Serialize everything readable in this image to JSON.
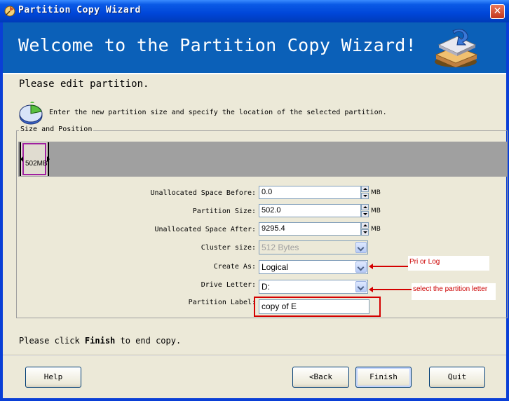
{
  "window": {
    "title": "Partition Copy Wizard",
    "close_glyph": "✕"
  },
  "banner": {
    "title": "Welcome to the Partition Copy Wizard!"
  },
  "heading": "Please edit partition.",
  "info_text": "Enter the new partition size and specify the location of the selected partition.",
  "group": {
    "legend": "Size and Position",
    "map_label": "502MB"
  },
  "fields": {
    "unalloc_before": {
      "label": "Unallocated Space Before:",
      "value": "0.0",
      "unit": "MB"
    },
    "partition_size": {
      "label": "Partition Size:",
      "value": "502.0",
      "unit": "MB"
    },
    "unalloc_after": {
      "label": "Unallocated Space After:",
      "value": "9295.4",
      "unit": "MB"
    },
    "cluster_size": {
      "label": "Cluster size:",
      "value": "512 Bytes"
    },
    "create_as": {
      "label": "Create As:",
      "value": "Logical"
    },
    "drive_letter": {
      "label": "Drive Letter:",
      "value": "D:"
    },
    "partition_label": {
      "label": "Partition Label:",
      "value": "copy of E"
    }
  },
  "annotations": {
    "create_as": "Pri or Log",
    "drive_letter": "select the partition  letter"
  },
  "footer": {
    "prefix": "Please click ",
    "bold": "Finish",
    "suffix": " to end copy."
  },
  "buttons": {
    "help": "Help",
    "back": "<Back",
    "finish": "Finish",
    "quit": "Quit"
  },
  "colors": {
    "titlebar": "#0046d8",
    "banner": "#0b60b8",
    "dialog": "#ece9d8",
    "annotation": "#d40000"
  }
}
